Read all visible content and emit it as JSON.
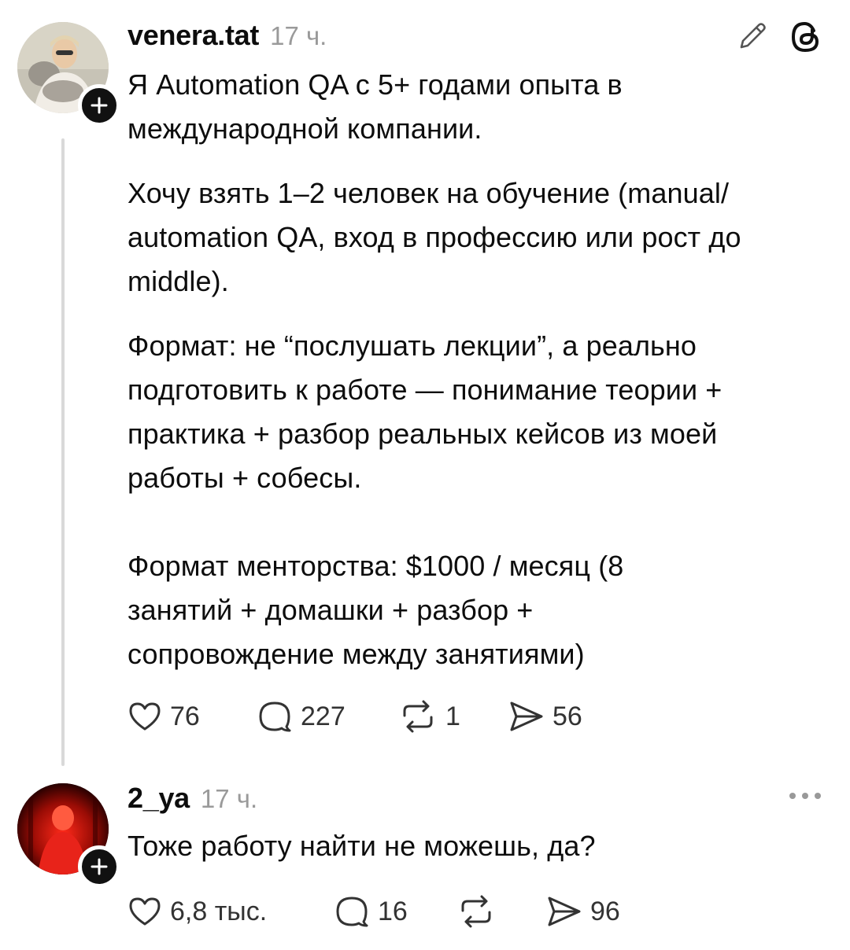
{
  "post": {
    "username": "venera.tat",
    "time": "17 ч.",
    "text_lines": {
      "p1": "Я Automation QA с 5+ годами опыта в международной компании.",
      "p2": "Хочу взять 1–2 человек на обучение (manual/ automation QA, вход в профессию или рост до middle).",
      "p3": "Формат: не “послушать лекции”, а реально подготовить к работе — понимание теории + практика + разбор реальных кейсов из моей работы + собесы.",
      "p4": "Формат менторства: $1000 / месяц (8 занятий + домашки + разбор + сопровождение между занятиями)"
    },
    "likes": "76",
    "comments": "227",
    "reposts": "1",
    "shares": "56",
    "icons": [
      "pencil-icon",
      "threads-logo-icon",
      "plus-icon",
      "heart-icon",
      "comment-icon",
      "repost-icon",
      "share-icon"
    ]
  },
  "reply": {
    "username": "2_ya",
    "time": "17 ч.",
    "text": "Тоже работу найти не можешь, да?",
    "likes": "6,8 тыс.",
    "comments": "16",
    "shares": "96",
    "icons": [
      "more-icon",
      "plus-icon",
      "heart-icon",
      "comment-icon",
      "repost-icon",
      "share-icon"
    ]
  }
}
